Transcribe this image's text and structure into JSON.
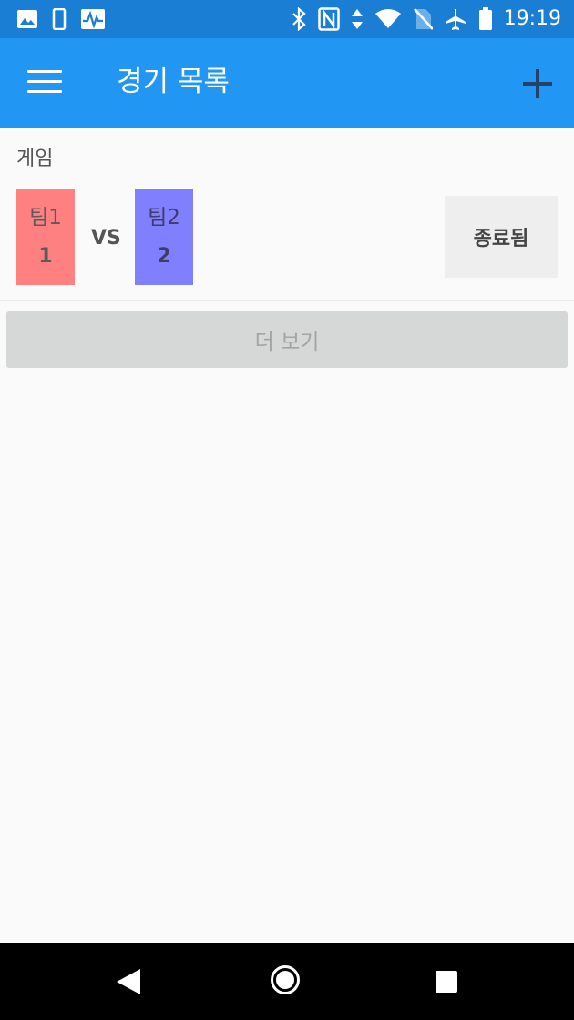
{
  "status_bar": {
    "time": "19:19",
    "left_icons": [
      "image-icon",
      "phone-icon",
      "activity-icon"
    ],
    "right_icons": [
      "bluetooth-icon",
      "nfc-icon",
      "data-arrows-icon",
      "wifi-icon",
      "no-sim-icon",
      "airplane-icon",
      "battery-icon"
    ]
  },
  "app_bar": {
    "title": "경기 목록",
    "menu_icon": "menu-icon",
    "add_icon": "plus-icon",
    "color": "#2196f3"
  },
  "game": {
    "label": "게임",
    "team1": {
      "name": "팀1",
      "score": "1",
      "color": "#ff8080"
    },
    "vs": "VS",
    "team2": {
      "name": "팀2",
      "score": "2",
      "color": "#8080ff"
    },
    "status": "종료됨"
  },
  "more_button": {
    "label": "더 보기"
  },
  "nav_bar": {
    "icons": [
      "back-icon",
      "home-icon",
      "recents-icon"
    ]
  }
}
